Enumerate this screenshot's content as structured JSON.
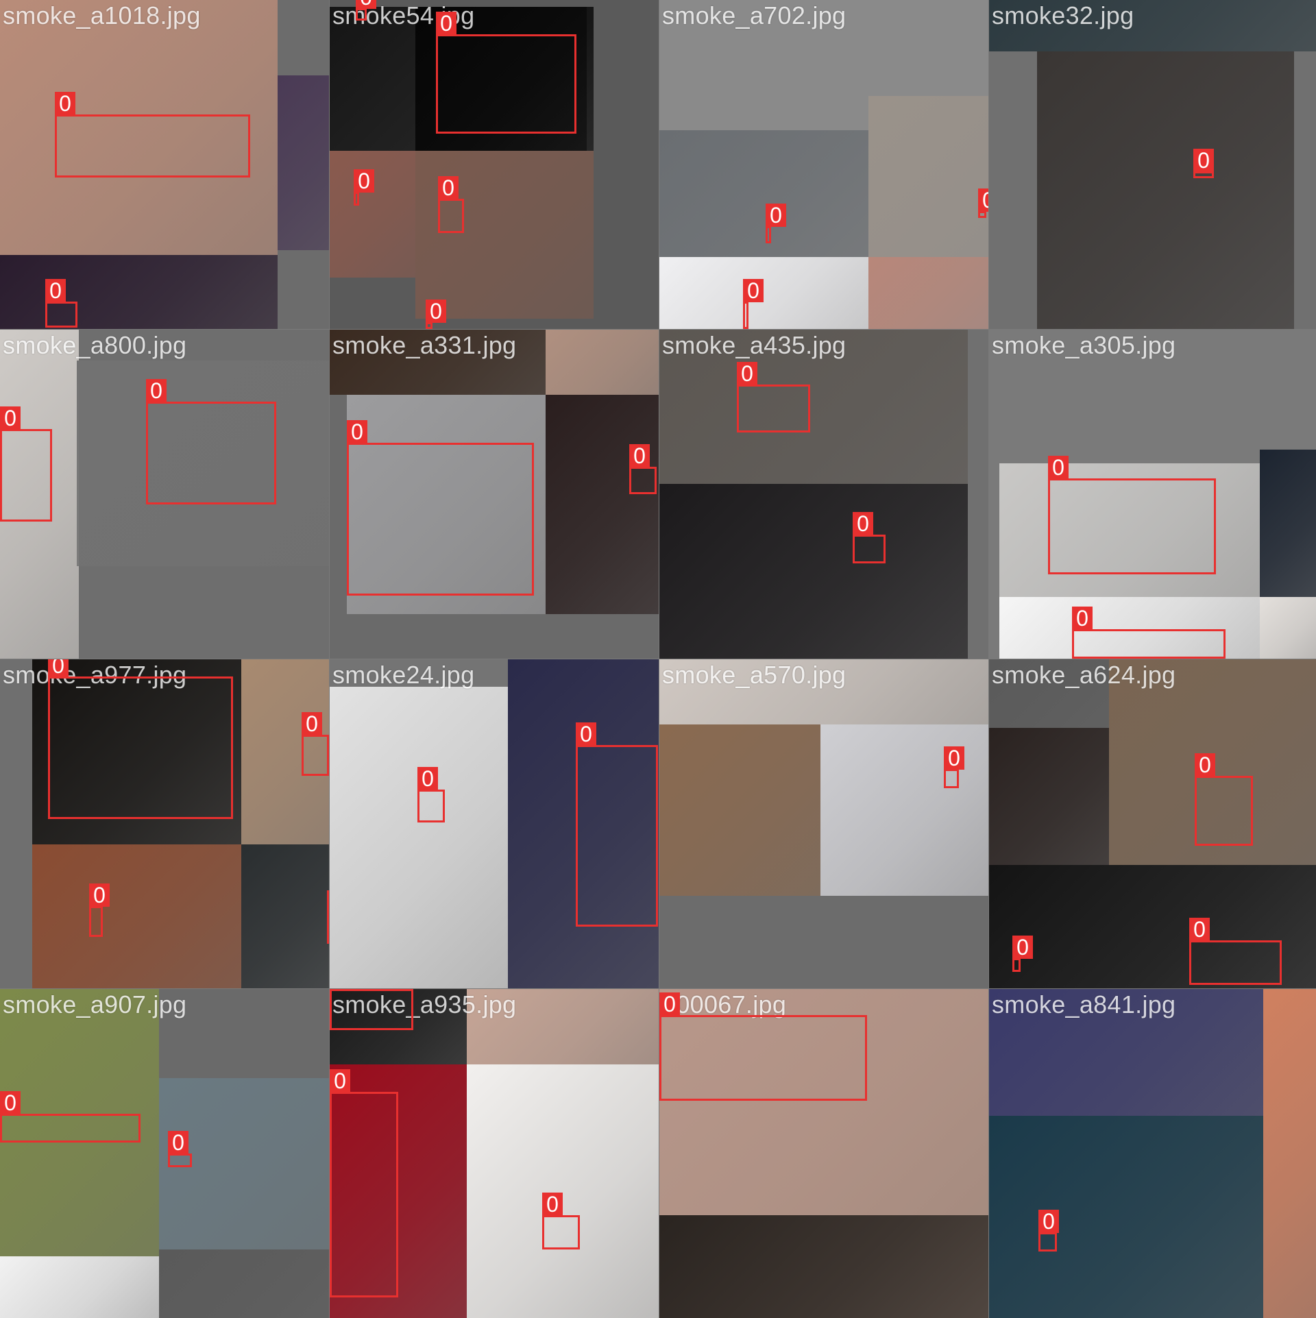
{
  "class_label": "0",
  "box_color": "#e8302f",
  "tiles": [
    {
      "filename": "smoke_a1018.jpg",
      "bg": "#6c6c6c",
      "boxes": 2
    },
    {
      "filename": "smoke54.jpg",
      "bg": "#5a5a5a",
      "boxes": 5
    },
    {
      "filename": "smoke_a702.jpg",
      "bg": "#8a8a8a",
      "boxes": 3
    },
    {
      "filename": "smoke32.jpg",
      "bg": "#707070",
      "boxes": 1
    },
    {
      "filename": "smoke_a800.jpg",
      "bg": "#6e6e6e",
      "boxes": 2
    },
    {
      "filename": "smoke_a331.jpg",
      "bg": "#6a6a6a",
      "boxes": 2
    },
    {
      "filename": "smoke_a435.jpg",
      "bg": "#707070",
      "boxes": 2
    },
    {
      "filename": "smoke_a305.jpg",
      "bg": "#7a7a7a",
      "boxes": 2
    },
    {
      "filename": "smoke_a977.jpg",
      "bg": "#6f6f6f",
      "boxes": 4
    },
    {
      "filename": "smoke24.jpg",
      "bg": "#747474",
      "boxes": 3
    },
    {
      "filename": "smoke_a570.jpg",
      "bg": "#6c6c6c",
      "boxes": 1
    },
    {
      "filename": "smoke_a624.jpg",
      "bg": "#6b6b6b",
      "boxes": 3
    },
    {
      "filename": "smoke_a907.jpg",
      "bg": "#6a6a6a",
      "boxes": 2
    },
    {
      "filename": "smoke_a935.jpg",
      "bg": "#6c6c6c",
      "boxes": 3
    },
    {
      "filename": "000067.jpg",
      "bg": "#8a7a70",
      "boxes": 1
    },
    {
      "filename": "smoke_a841.jpg",
      "bg": "#6c6c6c",
      "boxes": 1
    }
  ]
}
